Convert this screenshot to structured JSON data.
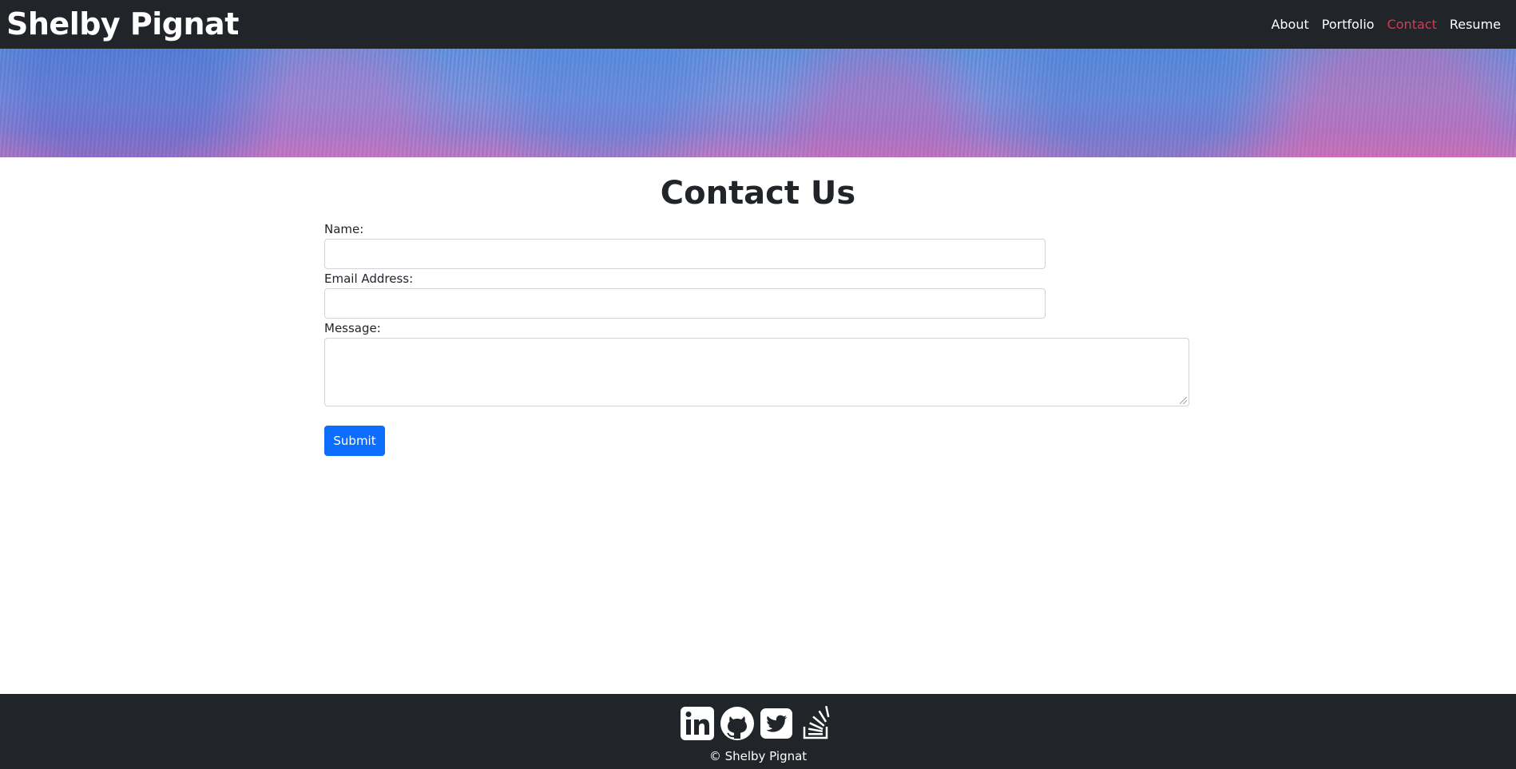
{
  "header": {
    "brand": "Shelby Pignat",
    "nav": [
      "About",
      "Portfolio",
      "Contact",
      "Resume"
    ],
    "active_nav": "Contact",
    "active_color": "#e0344f"
  },
  "banner": {
    "description": "blue-purple watercolor texture"
  },
  "main": {
    "title": "Contact Us",
    "form": {
      "name_label": "Name:",
      "name_value": "",
      "email_label": "Email Address:",
      "email_value": "",
      "message_label": "Message:",
      "message_value": "",
      "submit_label": "Submit"
    }
  },
  "footer": {
    "social_icons": [
      "linkedin-icon",
      "github-icon",
      "twitter-icon",
      "stackoverflow-icon"
    ],
    "copyright": "© Shelby Pignat"
  },
  "colors": {
    "navbar": "#212529",
    "primary": "#0d6efd",
    "footer": "#212529"
  }
}
